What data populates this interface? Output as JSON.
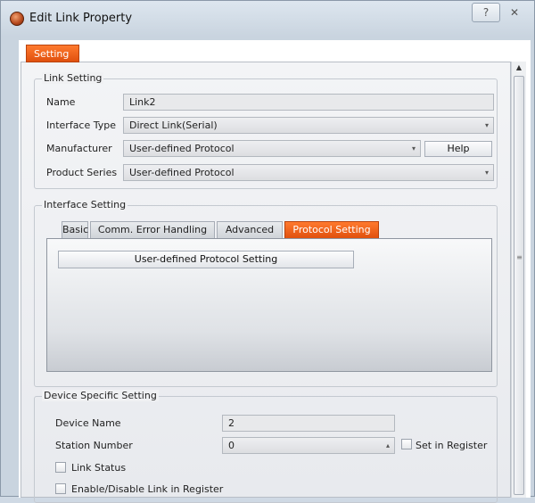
{
  "window": {
    "title": "Edit Link Property",
    "help_glyph": "?",
    "close_glyph": "✕"
  },
  "main_tab": {
    "label": "Setting"
  },
  "link_setting": {
    "title": "Link Setting",
    "name_label": "Name",
    "name_value": "Link2",
    "interface_type_label": "Interface Type",
    "interface_type_value": "Direct Link(Serial)",
    "manufacturer_label": "Manufacturer",
    "manufacturer_value": "User-defined Protocol",
    "help_button": "Help",
    "product_series_label": "Product Series",
    "product_series_value": "User-defined Protocol"
  },
  "interface_setting": {
    "title": "Interface Setting",
    "tabs": [
      "Basic",
      "Comm. Error Handling",
      "Advanced",
      "Protocol Setting"
    ],
    "active_tab": "Protocol Setting",
    "protocol_button": "User-defined Protocol Setting"
  },
  "device_setting": {
    "title": "Device Specific Setting",
    "device_name_label": "Device Name",
    "device_name_value": "2",
    "station_number_label": "Station Number",
    "station_number_value": "0",
    "set_in_register_label": "Set in Register",
    "link_status_label": "Link Status",
    "enable_disable_label": "Enable/Disable Link in Register"
  },
  "colors": {
    "accent": "#e8581a",
    "panel": "#f0f1f3"
  },
  "icons": {
    "dropdown": "▾",
    "spin_up": "▴",
    "scroll_up": "▲",
    "grip": "≡"
  }
}
